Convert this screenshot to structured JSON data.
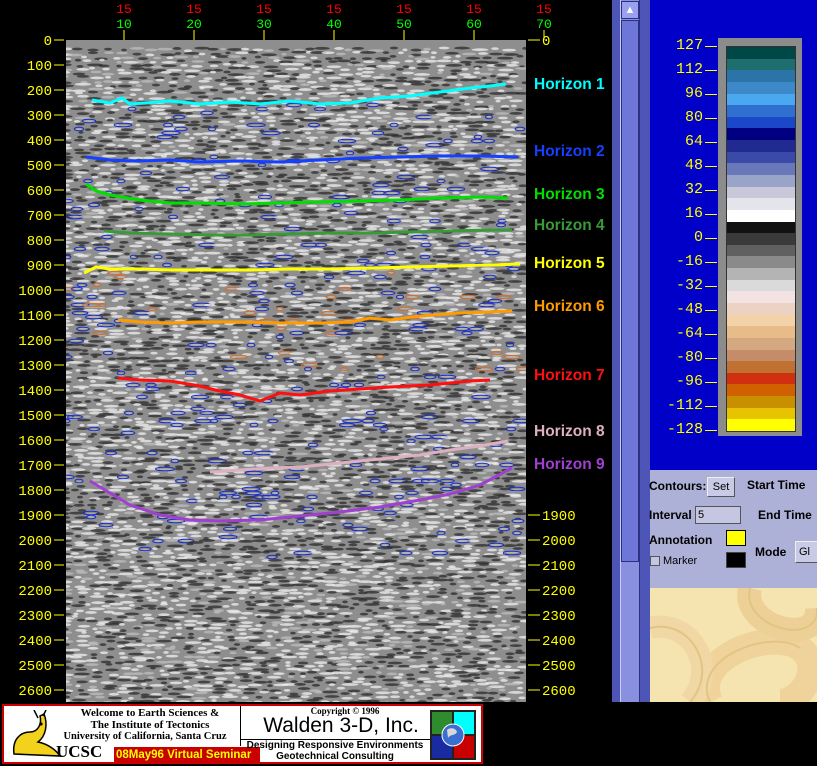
{
  "axes": {
    "top_trace_numbers": [
      "15",
      "15",
      "15",
      "15",
      "15",
      "15",
      "15"
    ],
    "top_cdp_labels": [
      "10",
      "20",
      "30",
      "40",
      "50",
      "60",
      "70"
    ],
    "left_time_labels": [
      "0",
      "100",
      "200",
      "300",
      "400",
      "500",
      "600",
      "700",
      "800",
      "900",
      "1000",
      "1100",
      "1200",
      "1300",
      "1400",
      "1500",
      "1600",
      "1700",
      "1800",
      "1900",
      "2000",
      "2100",
      "2200",
      "2300",
      "2400",
      "2500",
      "2600"
    ],
    "right_time_labels_top": [
      "0"
    ],
    "right_time_labels_bottom": [
      "1900",
      "2000",
      "2100",
      "2200",
      "2300",
      "2400",
      "2500",
      "2600"
    ],
    "label_color": "#ffff00",
    "trace_number_color": "#ff0000",
    "cdp_color": "#00ff00"
  },
  "horizons": [
    {
      "label": "Horizon 1",
      "color": "#00ffff"
    },
    {
      "label": "Horizon 2",
      "color": "#1540ff"
    },
    {
      "label": "Horizon 3",
      "color": "#00e000"
    },
    {
      "label": "Horizon 4",
      "color": "#3a9a3a"
    },
    {
      "label": "Horizon 5",
      "color": "#ffff00"
    },
    {
      "label": "Horizon 6",
      "color": "#ff9a00"
    },
    {
      "label": "Horizon 7",
      "color": "#ff1010"
    },
    {
      "label": "Horizon 8",
      "color": "#ddb0c0"
    },
    {
      "label": "Horizon 9",
      "color": "#a040d0"
    }
  ],
  "colorbar": {
    "ticks": [
      "127",
      "112",
      "96",
      "80",
      "64",
      "48",
      "32",
      "16",
      "0",
      "-16",
      "-32",
      "-48",
      "-64",
      "-80",
      "-96",
      "-112",
      "-128"
    ],
    "colors": [
      "#004848",
      "#1e6e70",
      "#2a74a8",
      "#3c88c8",
      "#4aa8f0",
      "#2f6fcf",
      "#1a48c8",
      "#000080",
      "#202a90",
      "#3a4aa8",
      "#6878b8",
      "#9aa4c8",
      "#c8c8d8",
      "#e4e4ec",
      "#ffffff",
      "#111111",
      "#3a3a3a",
      "#606060",
      "#8a8a8a",
      "#b4b4b4",
      "#dadada",
      "#f2e2e2",
      "#ecd2c2",
      "#f4d2a8",
      "#e8bc88",
      "#d4a880",
      "#c48c68",
      "#c07030",
      "#d03010",
      "#d06000",
      "#c89000",
      "#e8c400",
      "#ffff00"
    ]
  },
  "controls": {
    "contours_label": "Contours:",
    "set_button": "Set",
    "start_time_label": "Start Time",
    "interval_label": "Interval",
    "interval_value": "5",
    "end_time_label": "End Time",
    "annotation_label": "Annotation",
    "annotation_color": "#ffff00",
    "marker_label": "Marker",
    "mode_label": "Mode",
    "mode_value": "Gl"
  },
  "footer": {
    "welcome_line1": "Welcome to Earth Sciences &",
    "welcome_line2": "The Institute of Tectonics",
    "welcome_line3": "University of California, Santa Cruz",
    "ucsc": "UCSC",
    "seminar": "08May96 Virtual Seminar",
    "copyright": "Copyright © 1996",
    "company": "Walden 3-D, Inc.",
    "tagline1": "Designing Responsive Environments",
    "tagline2": "Geotechnical Consulting"
  }
}
